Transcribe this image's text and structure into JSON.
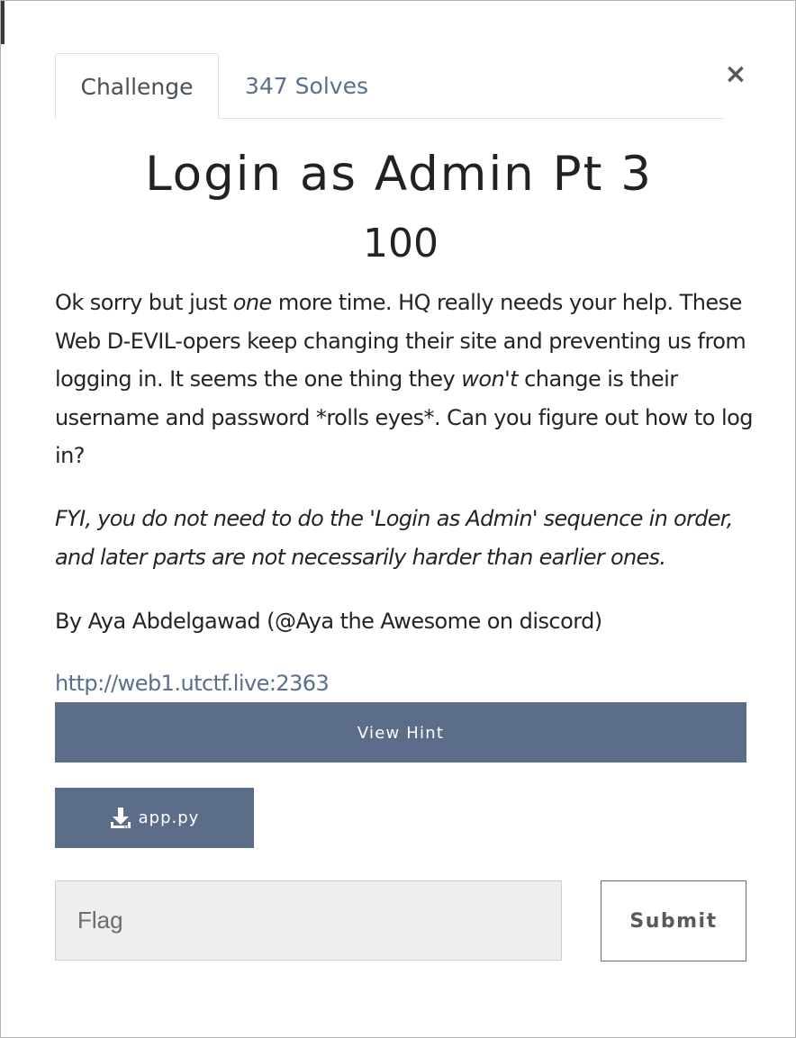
{
  "tabs": {
    "challenge": "Challenge",
    "solves": "347 Solves"
  },
  "close_label": "×",
  "challenge": {
    "title": "Login as Admin Pt 3",
    "points": "100",
    "description": {
      "part1": "Ok sorry but just ",
      "em1": "one",
      "part2": " more time. HQ really needs your help. These Web D-EVIL-opers keep changing their site and preventing us from logging in. It seems the one thing they ",
      "em2": "won't",
      "part3": " change is their username and password *rolls eyes*. Can you figure out how to log in?"
    },
    "fyi": "FYI, you do not need to do the 'Login as Admin' sequence in order, and later parts are not necessarily harder than earlier ones.",
    "author": "By Aya Abdelgawad (@Aya the Awesome on discord)",
    "link": "http://web1.utctf.live:2363"
  },
  "buttons": {
    "hint": "View Hint",
    "file": "app.py",
    "file_icon": "download-icon",
    "submit": "Submit"
  },
  "flag_input": {
    "placeholder": "Flag",
    "value": ""
  },
  "colors": {
    "accent": "#5b6d89",
    "link": "#5b6f8c"
  }
}
